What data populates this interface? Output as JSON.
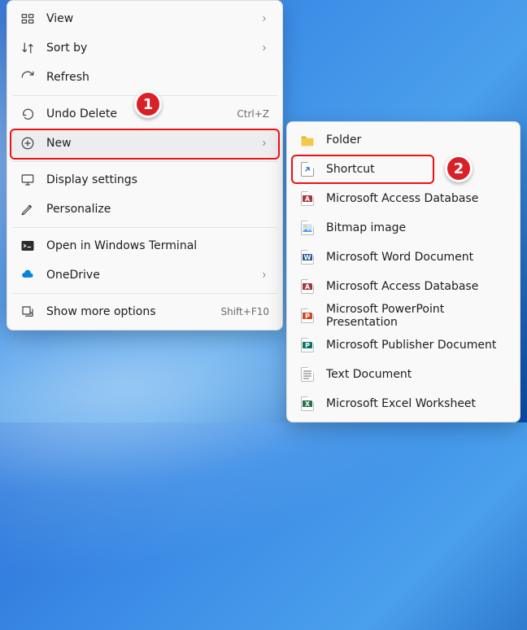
{
  "primary_menu": {
    "groups": [
      [
        {
          "icon": "view",
          "label": "View",
          "chev": true
        },
        {
          "icon": "sort",
          "label": "Sort by",
          "chev": true
        },
        {
          "icon": "refresh",
          "label": "Refresh"
        }
      ],
      [
        {
          "icon": "undo",
          "label": "Undo Delete",
          "shortcut": "Ctrl+Z"
        },
        {
          "icon": "new",
          "label": "New",
          "chev": true,
          "hover": true,
          "highlighted": true
        }
      ],
      [
        {
          "icon": "display",
          "label": "Display settings"
        },
        {
          "icon": "personalize",
          "label": "Personalize"
        }
      ],
      [
        {
          "icon": "terminal",
          "label": "Open in Windows Terminal"
        },
        {
          "icon": "onedrive",
          "label": "OneDrive",
          "chev": true
        }
      ],
      [
        {
          "icon": "more",
          "label": "Show more options",
          "shortcut": "Shift+F10"
        }
      ]
    ]
  },
  "sub_menu": {
    "items": [
      {
        "ft": "folder",
        "label": "Folder"
      },
      {
        "ft": "shortcut",
        "label": "Shortcut",
        "highlighted": true
      },
      {
        "ft": "access",
        "label": "Microsoft Access Database"
      },
      {
        "ft": "bitmap",
        "label": "Bitmap image"
      },
      {
        "ft": "word",
        "label": "Microsoft Word Document"
      },
      {
        "ft": "access",
        "label": "Microsoft Access Database"
      },
      {
        "ft": "powerpoint",
        "label": "Microsoft PowerPoint Presentation"
      },
      {
        "ft": "publisher",
        "label": "Microsoft Publisher Document"
      },
      {
        "ft": "text",
        "label": "Text Document"
      },
      {
        "ft": "excel",
        "label": "Microsoft Excel Worksheet"
      }
    ]
  },
  "annotations": {
    "badge1": "1",
    "badge2": "2"
  }
}
